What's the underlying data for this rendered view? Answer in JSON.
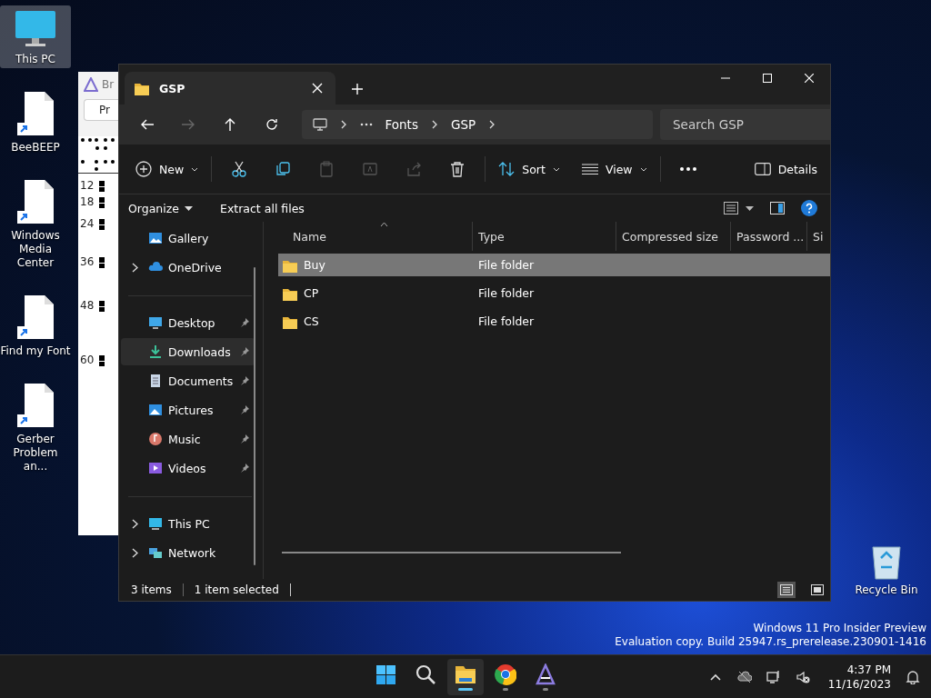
{
  "desktop_icons": [
    {
      "label": "This PC",
      "kind": "pc",
      "selected": true
    },
    {
      "label": "BeeBEEP",
      "kind": "shortcut",
      "selected": false
    },
    {
      "label": "Windows Media Center",
      "kind": "shortcut",
      "selected": false
    },
    {
      "label": "Find my Font",
      "kind": "shortcut",
      "selected": false
    },
    {
      "label": "Gerber Problem an...",
      "kind": "shortcut",
      "selected": false
    }
  ],
  "recycle_bin": {
    "label": "Recycle Bin"
  },
  "background_window": {
    "title": "Br",
    "button": "Pr",
    "row_numbers": [
      "12",
      "18",
      "24",
      "36",
      "48",
      "60"
    ]
  },
  "explorer": {
    "tab": {
      "title": "GSP"
    },
    "address": {
      "breadcrumbs": [
        "Fonts",
        "GSP"
      ]
    },
    "search": {
      "placeholder": "Search GSP"
    },
    "toolbar": {
      "new": "New",
      "sort": "Sort",
      "view": "View",
      "details": "Details"
    },
    "command_bar": {
      "items": [
        "Organize",
        "Extract all files"
      ]
    },
    "sidebar": {
      "items": [
        {
          "label": "Gallery",
          "kind": "gallery",
          "expandable": false,
          "pinned": false,
          "selected": false
        },
        {
          "label": "OneDrive",
          "kind": "cloud",
          "expandable": true,
          "pinned": false,
          "selected": false
        },
        {
          "label": "Desktop",
          "kind": "desktop",
          "expandable": false,
          "pinned": true,
          "selected": false
        },
        {
          "label": "Downloads",
          "kind": "downloads",
          "expandable": false,
          "pinned": true,
          "selected": true
        },
        {
          "label": "Documents",
          "kind": "documents",
          "expandable": false,
          "pinned": true,
          "selected": false
        },
        {
          "label": "Pictures",
          "kind": "pictures",
          "expandable": false,
          "pinned": true,
          "selected": false
        },
        {
          "label": "Music",
          "kind": "music",
          "expandable": false,
          "pinned": true,
          "selected": false
        },
        {
          "label": "Videos",
          "kind": "videos",
          "expandable": false,
          "pinned": true,
          "selected": false
        },
        {
          "label": "This PC",
          "kind": "pc",
          "expandable": true,
          "pinned": false,
          "selected": false
        },
        {
          "label": "Network",
          "kind": "network",
          "expandable": true,
          "pinned": false,
          "selected": false
        }
      ]
    },
    "table": {
      "columns": [
        "Name",
        "Type",
        "Compressed size",
        "Password ...",
        "Si"
      ],
      "rows": [
        {
          "name": "Buy",
          "type": "File folder",
          "selected": true
        },
        {
          "name": "CP",
          "type": "File folder",
          "selected": false
        },
        {
          "name": "CS",
          "type": "File folder",
          "selected": false
        }
      ]
    },
    "status_bar": {
      "count": "3 items",
      "selection": "1 item selected"
    }
  },
  "watermark_text": [
    "Windows 11 Pro Insider Preview",
    "Evaluation copy. Build 25947.rs_prerelease.230901-1416"
  ],
  "taskbar": {
    "apps": [
      {
        "kind": "start",
        "active": false
      },
      {
        "kind": "search",
        "active": false
      },
      {
        "kind": "explorer",
        "active": true
      },
      {
        "kind": "chrome",
        "active": false
      },
      {
        "kind": "app",
        "active": false
      }
    ],
    "time": "4:37 PM",
    "date": "11/16/2023"
  }
}
